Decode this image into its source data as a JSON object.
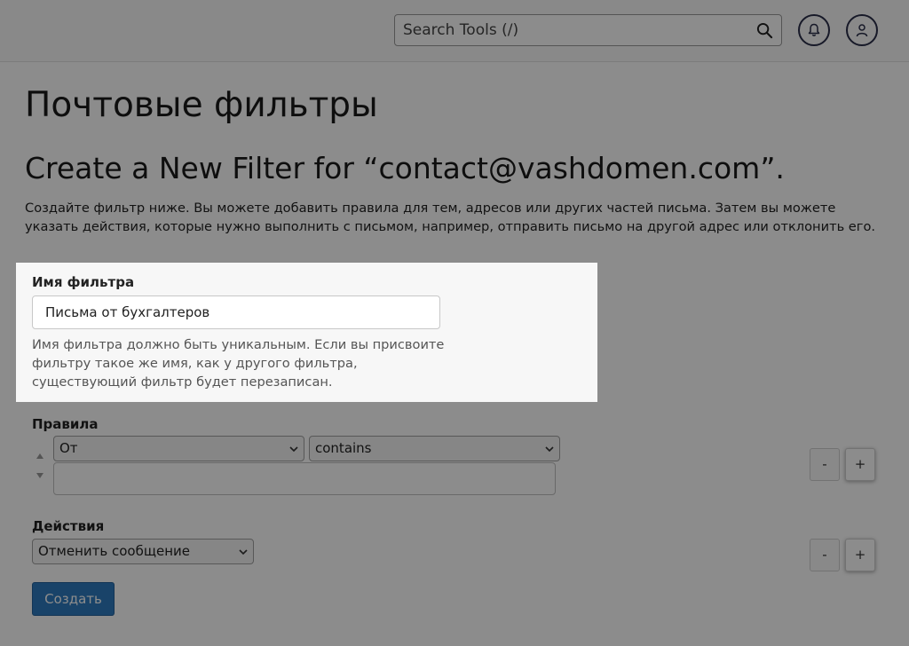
{
  "header": {
    "search_placeholder": "Search Tools (/)",
    "search_icon": "search-icon",
    "notifications_icon": "bell-icon",
    "user_icon": "user-icon"
  },
  "page": {
    "title": "Почтовые фильтры",
    "subtitle": "Create a New Filter for “contact@vashdomen.com”.",
    "intro": "Создайте фильтр ниже. Вы можете добавить правила для тем, адресов или других частей письма. Затем вы можете указать действия, которые нужно выполнить с письмом, например, отправить письмо на другой адрес или отклонить его."
  },
  "filter_name": {
    "label": "Имя фильтра",
    "value": "Письма от бухгалтеров",
    "help": "Имя фильтра должно быть уникальным. Если вы присвоите фильтру такое же имя, как у другого фильтра, существующий фильтр будет перезаписан."
  },
  "rules": {
    "label": "Правила",
    "field_select": "От",
    "operator_select": "contains",
    "value": "",
    "minus_label": "-",
    "plus_label": "+"
  },
  "actions": {
    "label": "Действия",
    "action_select": "Отменить сообщение",
    "minus_label": "-",
    "plus_label": "+"
  },
  "submit": {
    "label": "Создать"
  },
  "colors": {
    "primary_button": "#2f7bbf",
    "highlight_panel": "#f7f7f7",
    "overlay": "rgba(0,0,0,0.45)"
  }
}
